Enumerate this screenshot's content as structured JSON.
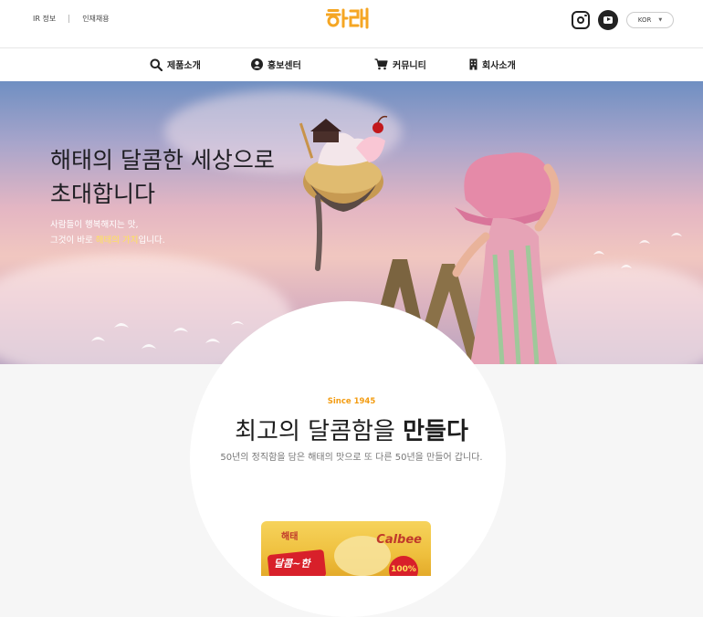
{
  "topbar": {
    "links": [
      "IR 정보",
      "인재채용"
    ],
    "logo_text": "해태",
    "social": [
      "instagram-icon",
      "youtube-icon"
    ],
    "language": {
      "selected": "KOR"
    }
  },
  "nav": {
    "items": [
      {
        "label": "제품소개",
        "icon": "search-icon"
      },
      {
        "label": "홍보센터",
        "icon": "user-circle-icon"
      },
      {
        "label": "커뮤니티",
        "icon": "cart-icon"
      },
      {
        "label": "회사소개",
        "icon": "building-icon"
      }
    ]
  },
  "hero": {
    "title_line1": "해태의 달콤한 세상으로",
    "title_line2": "초대합니다",
    "desc_line1": "사람들이 행복해지는 맛,",
    "desc_line2_prefix": "그것이 바로 ",
    "desc_line2_highlight": "해태의 가치",
    "desc_line2_suffix": "입니다."
  },
  "section": {
    "since": "Since 1945",
    "title_regular": "최고의 달콤함을 ",
    "title_bold": "만들다",
    "subtitle": "50년의 정직함을 담은 해태의 맛으로 또 다른 50년을 만들어 갑니다."
  },
  "product": {
    "brand": "Calbee",
    "label": "달콤~한",
    "badge": "100%",
    "logo": "해태"
  },
  "colors": {
    "accent": "#f39c12",
    "logo": "#f5a623",
    "highlight": "#ffe25c"
  }
}
